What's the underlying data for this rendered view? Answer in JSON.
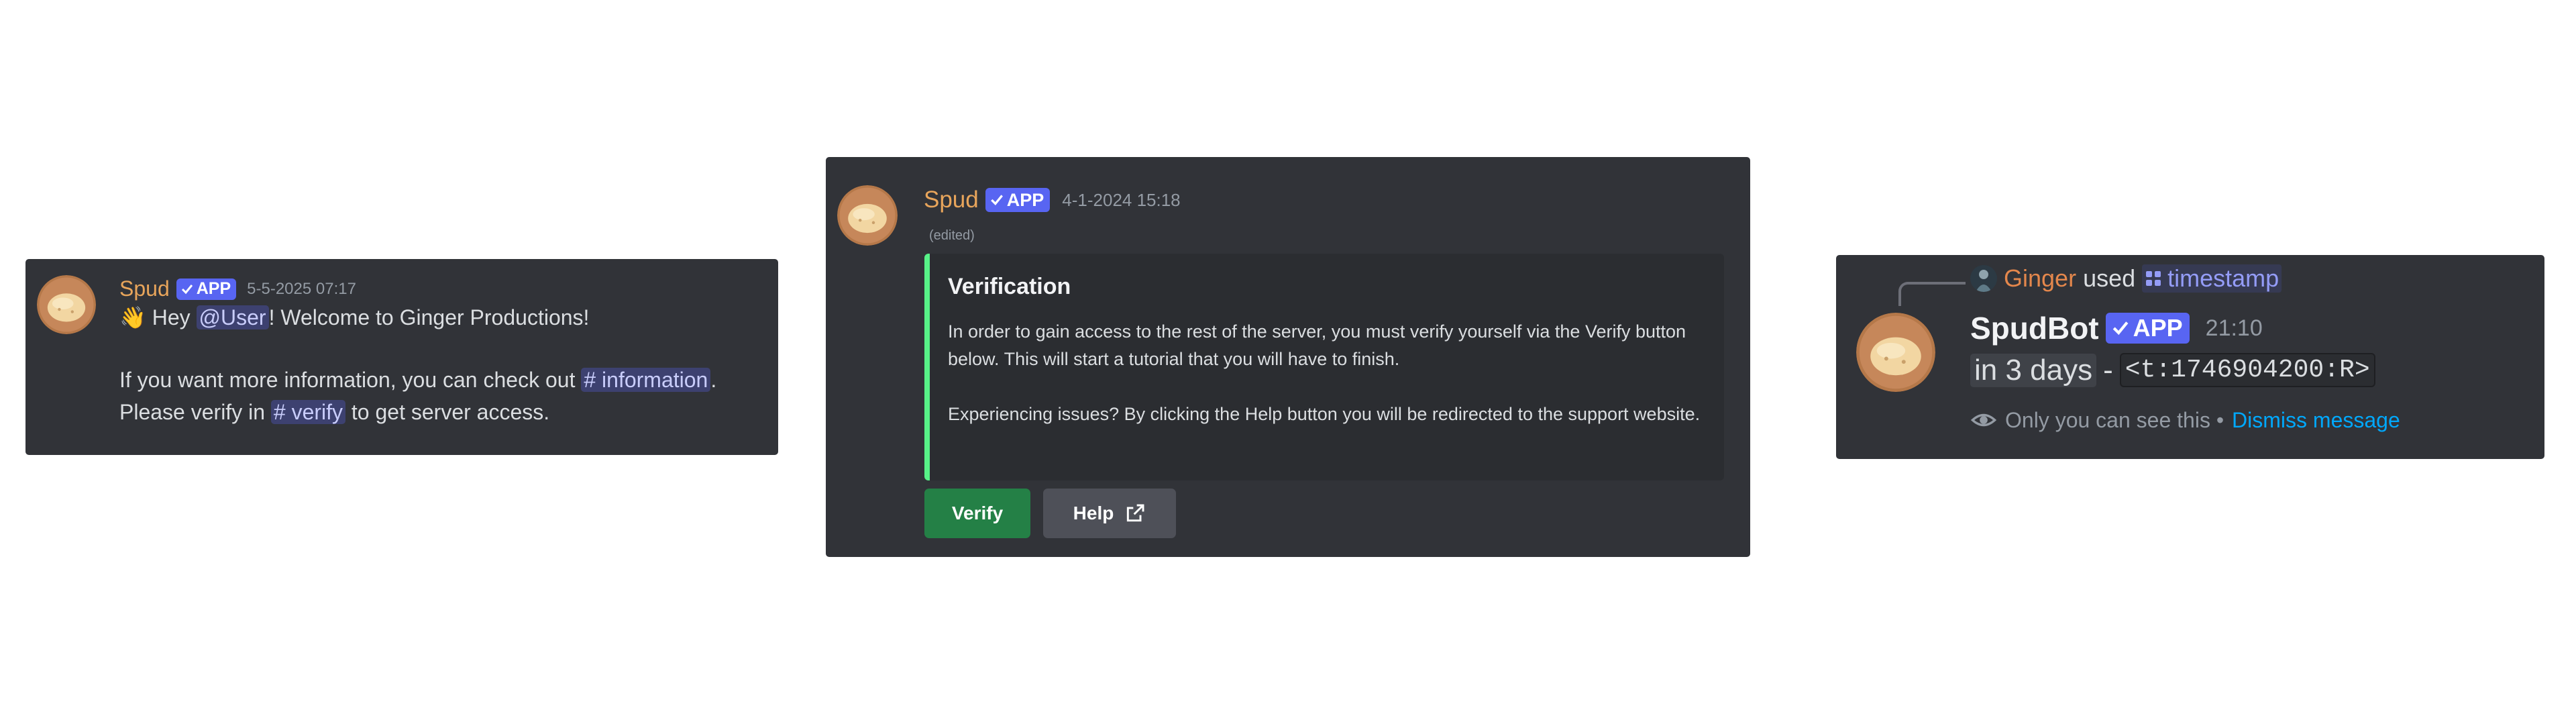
{
  "card1": {
    "author": "Spud",
    "badge": "APP",
    "timestamp": "5-5-2025 07:17",
    "line1": {
      "emoji": "👋",
      "pre": " Hey ",
      "mention": "@User",
      "post": "! Welcome to Ginger Productions!"
    },
    "line2": {
      "pre": "If you want more information, you can check out ",
      "channel": "# information",
      "post": "."
    },
    "line3": {
      "pre": "Please verify in ",
      "channel": "# verify",
      "post": " to get server access."
    }
  },
  "card2": {
    "author": "Spud",
    "badge": "APP",
    "timestamp": "4-1-2024 15:18",
    "edited": "(edited)",
    "embed": {
      "title": "Verification",
      "paragraph1": "In order to gain access to the rest of the server, you must verify yourself via the Verify button below. This will start a tutorial that you will have to finish.",
      "paragraph2": "Experiencing issues? By clicking the Help button you will be redirected to the support website.",
      "accent_color": "#57f287"
    },
    "buttons": {
      "verify": "Verify",
      "help": "Help"
    }
  },
  "card3": {
    "reply": {
      "user": "Ginger",
      "used": "used",
      "command": "timestamp"
    },
    "author": "SpudBot",
    "badge": "APP",
    "timestamp": "21:10",
    "relative_time": "in 3 days",
    "separator": "-",
    "code": "<t:1746904200:R>",
    "ephemeral_text": "Only you can see this •",
    "dismiss": "Dismiss message"
  },
  "colors": {
    "background": "#313338",
    "brand": "#5865f2",
    "success_button": "#248046",
    "secondary_button": "#4e5058",
    "author_color": "#e8a55b"
  },
  "icons": [
    "waving-hand-emoji",
    "checkmark-icon",
    "external-link-icon",
    "slash-command-icon",
    "eye-icon"
  ]
}
